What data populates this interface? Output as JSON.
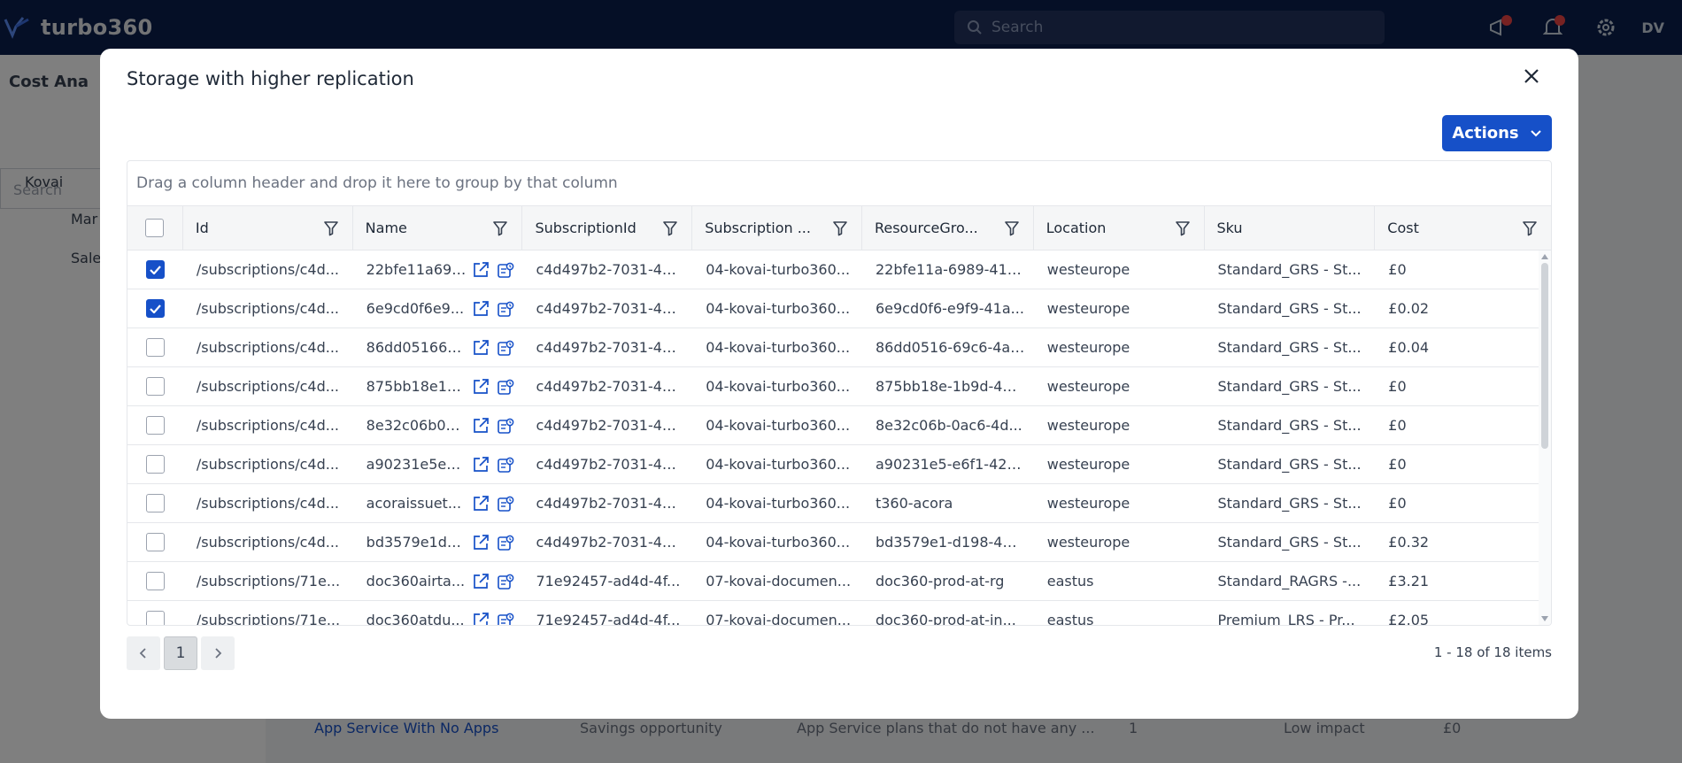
{
  "app": {
    "brand": "turbo360",
    "search_placeholder": "Search",
    "user_initials": "DV",
    "left_title": "Cost Ana",
    "left_search": "Search",
    "tree": [
      "Kovai",
      "Mar",
      "Sale"
    ],
    "bg_row": {
      "name": "App Service With No Apps",
      "type": "Savings opportunity",
      "desc": "App Service plans that do not have any ...",
      "count": "1",
      "impact": "Low impact",
      "cost": "£0"
    }
  },
  "modal": {
    "title": "Storage with higher replication",
    "actions_label": "Actions",
    "group_hint": "Drag a column header and drop it here to group by that column",
    "columns": [
      "Id",
      "Name",
      "SubscriptionId",
      "Subscription ...",
      "ResourceGro...",
      "Location",
      "Sku",
      "Cost"
    ],
    "rows": [
      {
        "checked": true,
        "id": "/subscriptions/c4d...",
        "name": "22bfe11a698...",
        "sub_id": "c4d497b2-7031-4a1...",
        "sub_name": "04-kovai-turbo360...",
        "rg": "22bfe11a-6989-414...",
        "location": "westeurope",
        "sku": "Standard_GRS - St...",
        "cost": "£0"
      },
      {
        "checked": true,
        "id": "/subscriptions/c4d...",
        "name": "6e9cd0f6e9...",
        "sub_id": "c4d497b2-7031-4a1...",
        "sub_name": "04-kovai-turbo360...",
        "rg": "6e9cd0f6-e9f9-41a...",
        "location": "westeurope",
        "sku": "Standard_GRS - St...",
        "cost": "£0.02"
      },
      {
        "checked": false,
        "id": "/subscriptions/c4d...",
        "name": "86dd051669...",
        "sub_id": "c4d497b2-7031-4a1...",
        "sub_name": "04-kovai-turbo360...",
        "rg": "86dd0516-69c6-4af...",
        "location": "westeurope",
        "sku": "Standard_GRS - St...",
        "cost": "£0.04"
      },
      {
        "checked": false,
        "id": "/subscriptions/c4d...",
        "name": "875bb18e1b...",
        "sub_id": "c4d497b2-7031-4a1...",
        "sub_name": "04-kovai-turbo360...",
        "rg": "875bb18e-1b9d-41f...",
        "location": "westeurope",
        "sku": "Standard_GRS - St...",
        "cost": "£0"
      },
      {
        "checked": false,
        "id": "/subscriptions/c4d...",
        "name": "8e32c06b0a...",
        "sub_id": "c4d497b2-7031-4a1...",
        "sub_name": "04-kovai-turbo360...",
        "rg": "8e32c06b-0ac6-4d...",
        "location": "westeurope",
        "sku": "Standard_GRS - St...",
        "cost": "£0"
      },
      {
        "checked": false,
        "id": "/subscriptions/c4d...",
        "name": "a90231e5e6...",
        "sub_id": "c4d497b2-7031-4a1...",
        "sub_name": "04-kovai-turbo360...",
        "rg": "a90231e5-e6f1-427...",
        "location": "westeurope",
        "sku": "Standard_GRS - St...",
        "cost": "£0"
      },
      {
        "checked": false,
        "id": "/subscriptions/c4d...",
        "name": "acoraissuet...",
        "sub_id": "c4d497b2-7031-4a1...",
        "sub_name": "04-kovai-turbo360...",
        "rg": "t360-acora",
        "location": "westeurope",
        "sku": "Standard_GRS - St...",
        "cost": "£0"
      },
      {
        "checked": false,
        "id": "/subscriptions/c4d...",
        "name": "bd3579e1d1...",
        "sub_id": "c4d497b2-7031-4a1...",
        "sub_name": "04-kovai-turbo360...",
        "rg": "bd3579e1-d198-47c...",
        "location": "westeurope",
        "sku": "Standard_GRS - St...",
        "cost": "£0.32"
      },
      {
        "checked": false,
        "id": "/subscriptions/71e...",
        "name": "doc360airta...",
        "sub_id": "71e92457-ad4d-4f...",
        "sub_name": "07-kovai-documen...",
        "rg": "doc360-prod-at-rg",
        "location": "eastus",
        "sku": "Standard_RAGRS -...",
        "cost": "£3.21"
      },
      {
        "checked": false,
        "id": "/subscriptions/71e...",
        "name": "doc360atdu...",
        "sub_id": "71e92457-ad4d-4f...",
        "sub_name": "07-kovai-documen...",
        "rg": "doc360-prod-at-in...",
        "location": "eastus",
        "sku": "Premium_LRS - Pr...",
        "cost": "£2.05"
      }
    ],
    "pager": {
      "current_page": "1",
      "summary": "1 - 18 of 18 items"
    }
  },
  "colors": {
    "primary": "#1650c8",
    "topbar": "#0b1f4d"
  }
}
